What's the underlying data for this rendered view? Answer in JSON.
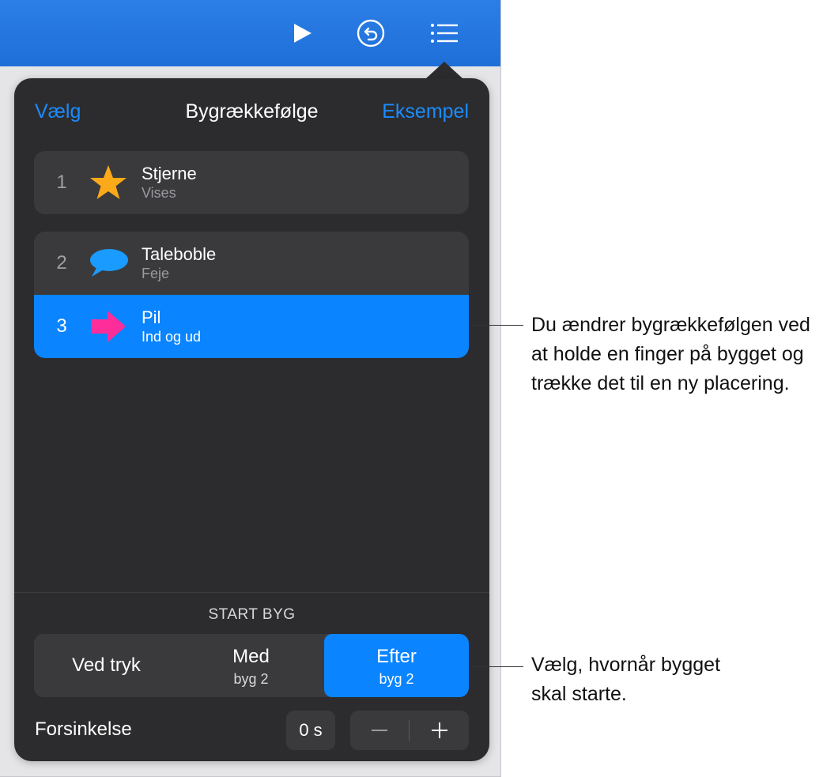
{
  "toolbar": {
    "play_icon": "play-icon",
    "undo_icon": "undo-icon",
    "list_icon": "list-icon"
  },
  "popover": {
    "left_label": "Vælg",
    "title": "Bygrækkefølge",
    "right_label": "Eksempel"
  },
  "builds": [
    {
      "number": "1",
      "name": "Stjerne",
      "effect": "Vises",
      "icon": "star-icon",
      "color": "#fba919"
    },
    {
      "number": "2",
      "name": "Taleboble",
      "effect": "Feje",
      "icon": "speech-bubble-icon",
      "color": "#1a9bff"
    },
    {
      "number": "3",
      "name": "Pil",
      "effect": "Ind og ud",
      "icon": "arrow-icon",
      "color": "#ff2d9a"
    }
  ],
  "start_build": {
    "label": "START BYG",
    "options": [
      {
        "label": "Ved tryk",
        "sub": ""
      },
      {
        "label": "Med",
        "sub": "byg 2"
      },
      {
        "label": "Efter",
        "sub": "byg 2"
      }
    ],
    "selected": "Efter"
  },
  "delay": {
    "label": "Forsinkelse",
    "value": "0 s"
  },
  "callouts": {
    "reorder": "Du ændrer bygrækkefølgen ved at holde en finger på bygget og trække det til en ny placering.",
    "start": "Vælg, hvornår bygget skal starte."
  },
  "colors": {
    "accent": "#0a84ff",
    "toolbar": "#1f6fd8",
    "panel": "#2c2c2e"
  }
}
